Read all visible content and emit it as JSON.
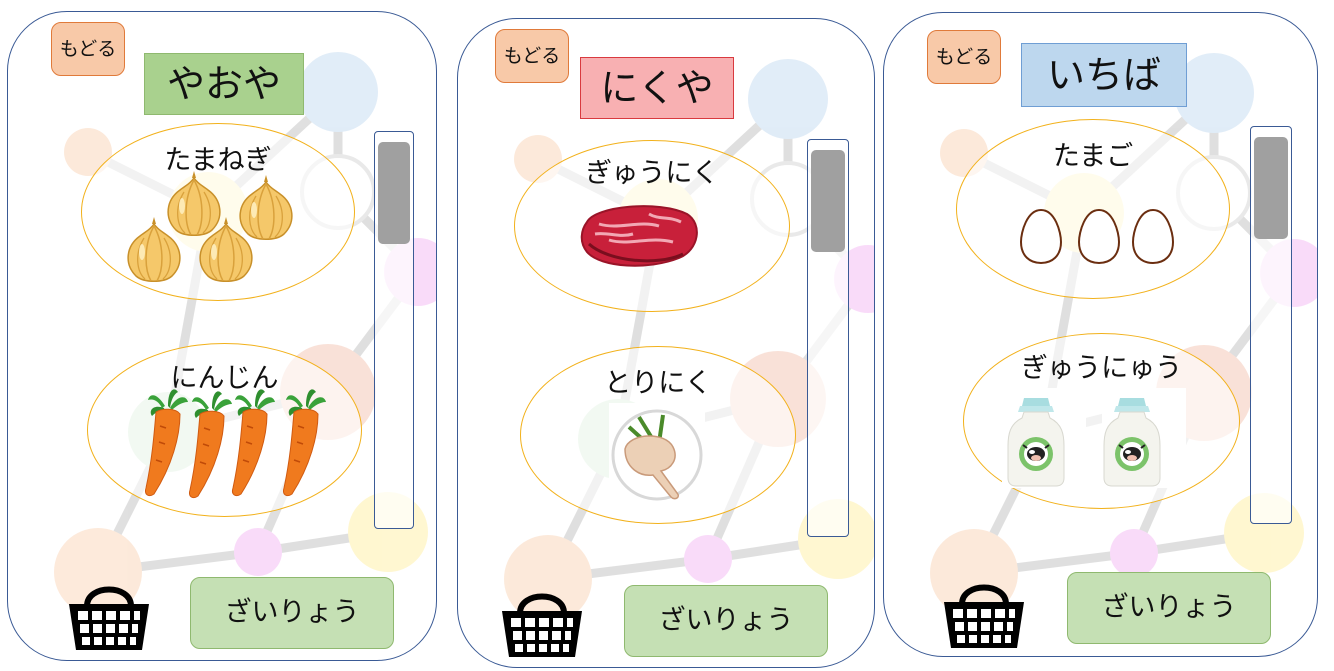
{
  "screens": [
    {
      "back_label": "もどる",
      "title": "やおや",
      "title_color": "#a9d18e",
      "items": [
        {
          "label": "たまねぎ",
          "icon": "onion-icon",
          "count": 4
        },
        {
          "label": "にんじん",
          "icon": "carrot-icon",
          "count": 4
        }
      ],
      "basket_icon": "basket-icon",
      "ingredients_label": "ざいりょう"
    },
    {
      "back_label": "もどる",
      "title": "にくや",
      "title_color": "#f8b0b2",
      "items": [
        {
          "label": "ぎゅうにく",
          "icon": "beef-icon",
          "count": 1
        },
        {
          "label": "とりにく",
          "icon": "chicken-leg-icon",
          "count": 1
        }
      ],
      "basket_icon": "basket-icon",
      "ingredients_label": "ざいりょう"
    },
    {
      "back_label": "もどる",
      "title": "いちば",
      "title_color": "#bdd7ee",
      "items": [
        {
          "label": "たまご",
          "icon": "egg-icon",
          "count": 3
        },
        {
          "label": "ぎゅうにゅう",
          "icon": "milk-bottle-icon",
          "count": 2
        }
      ],
      "basket_icon": "basket-icon",
      "ingredients_label": "ざいりょう"
    }
  ],
  "colors": {
    "frame_border": "#3a5a95",
    "back_button": "#f8c9a8",
    "item_border": "#f2b11b",
    "ingredients_button": "#c5e0b4",
    "scroll_thumb": "#a0a0a0"
  }
}
